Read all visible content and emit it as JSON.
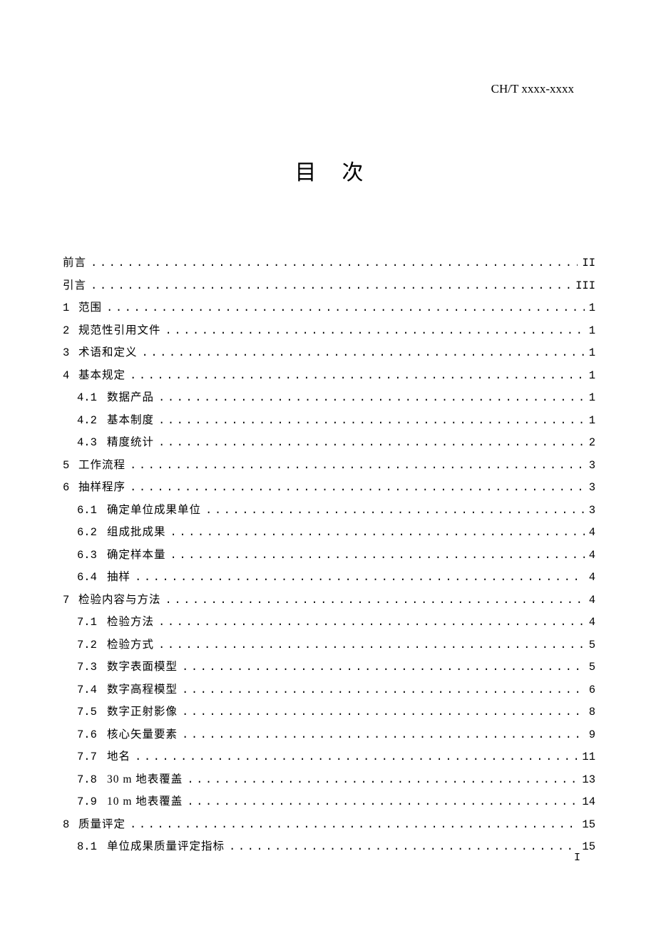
{
  "header_code": "CH/T xxxx-xxxx",
  "title": "目次",
  "toc": [
    {
      "num": "",
      "label": "前言",
      "page": "II",
      "indent": 0
    },
    {
      "num": "",
      "label": "引言",
      "page": "III",
      "indent": 0
    },
    {
      "num": "1",
      "label": "范围",
      "page": "1",
      "indent": 0
    },
    {
      "num": "2",
      "label": "规范性引用文件",
      "page": "1",
      "indent": 0
    },
    {
      "num": "3",
      "label": "术语和定义",
      "page": "1",
      "indent": 0
    },
    {
      "num": "4",
      "label": "基本规定",
      "page": "1",
      "indent": 0
    },
    {
      "num": "4.1",
      "label": "数据产品",
      "page": "1",
      "indent": 1
    },
    {
      "num": "4.2",
      "label": "基本制度",
      "page": "1",
      "indent": 1
    },
    {
      "num": "4.3",
      "label": "精度统计",
      "page": "2",
      "indent": 1
    },
    {
      "num": "5",
      "label": "工作流程",
      "page": "3",
      "indent": 0
    },
    {
      "num": "6",
      "label": "抽样程序",
      "page": "3",
      "indent": 0
    },
    {
      "num": "6.1",
      "label": "确定单位成果单位",
      "page": "3",
      "indent": 1
    },
    {
      "num": "6.2",
      "label": "组成批成果",
      "page": "4",
      "indent": 1
    },
    {
      "num": "6.3",
      "label": "确定样本量",
      "page": "4",
      "indent": 1
    },
    {
      "num": "6.4",
      "label": "抽样",
      "page": "4",
      "indent": 1
    },
    {
      "num": "7",
      "label": "检验内容与方法",
      "page": "4",
      "indent": 0
    },
    {
      "num": "7.1",
      "label": "检验方法",
      "page": "4",
      "indent": 1
    },
    {
      "num": "7.2",
      "label": "检验方式",
      "page": "5",
      "indent": 1
    },
    {
      "num": "7.3",
      "label": "数字表面模型",
      "page": "5",
      "indent": 1
    },
    {
      "num": "7.4",
      "label": "数字高程模型",
      "page": "6",
      "indent": 1
    },
    {
      "num": "7.5",
      "label": "数字正射影像",
      "page": "8",
      "indent": 1
    },
    {
      "num": "7.6",
      "label": "核心矢量要素",
      "page": "9",
      "indent": 1
    },
    {
      "num": "7.7",
      "label": "地名",
      "page": "11",
      "indent": 1
    },
    {
      "num": "7.8",
      "label": "30 m 地表覆盖",
      "page": "13",
      "indent": 1
    },
    {
      "num": "7.9",
      "label": "10 m 地表覆盖",
      "page": "14",
      "indent": 1
    },
    {
      "num": "8",
      "label": "质量评定",
      "page": "15",
      "indent": 0
    },
    {
      "num": "8.1",
      "label": "单位成果质量评定指标",
      "page": "15",
      "indent": 1
    }
  ],
  "page_number": "I"
}
